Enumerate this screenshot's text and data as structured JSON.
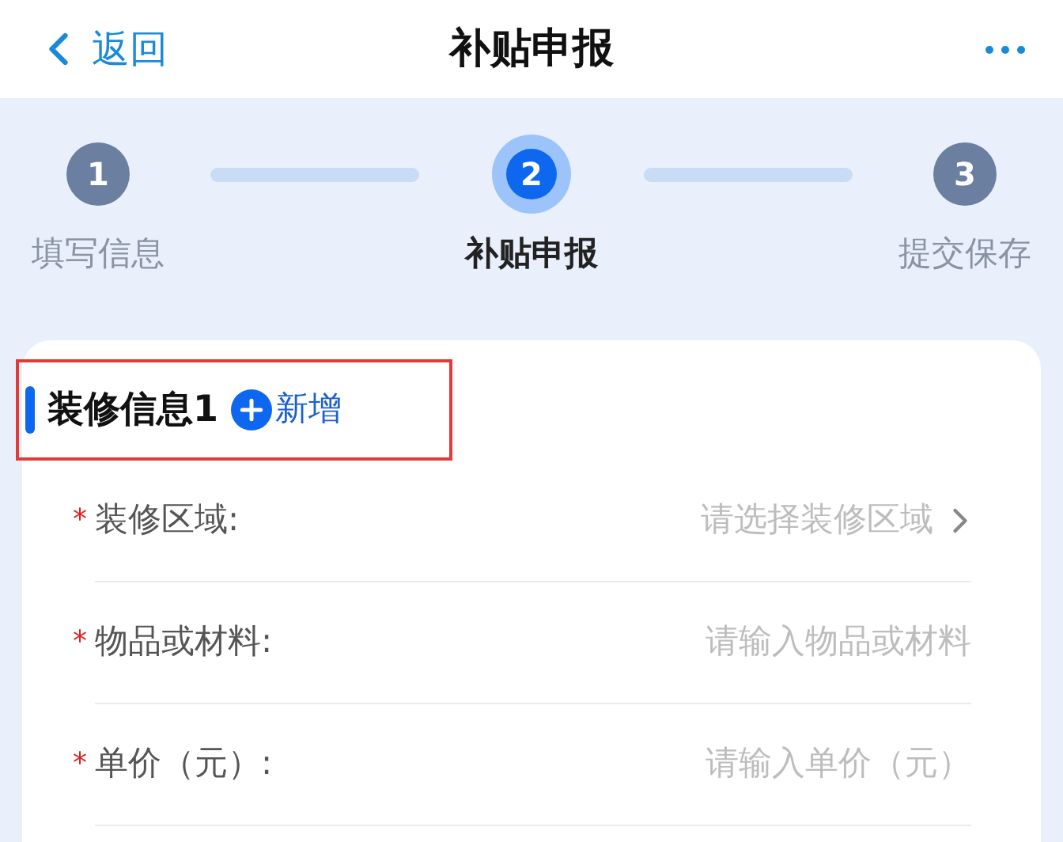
{
  "nav": {
    "back": "返回",
    "title": "补贴申报"
  },
  "steps": [
    {
      "number": "1",
      "label": "填写信息",
      "selected": false
    },
    {
      "number": "2",
      "label": "补贴申报",
      "selected": true
    },
    {
      "number": "3",
      "label": "提交保存",
      "selected": false
    }
  ],
  "section": {
    "title": "装修信息1",
    "add": "新增",
    "highlighted": true
  },
  "fields": [
    {
      "kind": "select",
      "label": "装修区域:",
      "marker": "*",
      "placeholder": "请选择装修区域"
    },
    {
      "kind": "input",
      "label": "物品或材料:",
      "marker": "*",
      "placeholder": "请输入物品或材料"
    },
    {
      "kind": "input",
      "label": "单价（元）:",
      "marker": "*",
      "placeholder": "请输入单价（元）"
    }
  ]
}
